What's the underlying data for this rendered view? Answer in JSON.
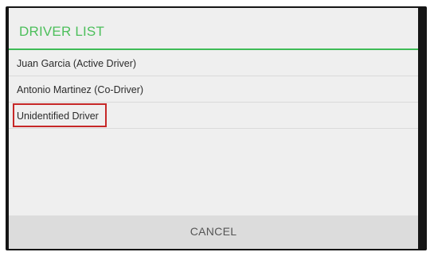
{
  "dialog": {
    "title": "DRIVER LIST",
    "accent_color": "#4cbf5b",
    "highlight_color": "#c62828",
    "items": [
      {
        "label": "Juan Garcia (Active Driver)"
      },
      {
        "label": "Antonio Martinez (Co-Driver)"
      },
      {
        "label": "Unidentified Driver",
        "highlighted": true
      }
    ],
    "cancel_label": "CANCEL"
  }
}
